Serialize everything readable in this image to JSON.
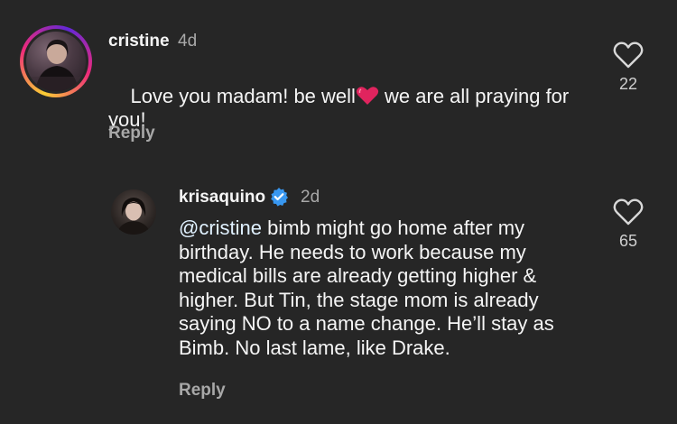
{
  "comment": {
    "username": "cristine",
    "time": "4d",
    "text_line1": "Love you madam! be well",
    "text_line1b": " we are all praying for",
    "text_line2": "you!",
    "emoji": "red-heart",
    "reply_label": "Reply",
    "likes": "22"
  },
  "reply": {
    "username": "krisaquino",
    "verified": true,
    "time": "2d",
    "mention": "@cristine",
    "lines": [
      " bimb might go home after my",
      "birthday. He needs to work because my",
      "medical bills are already getting higher &",
      "higher. But Tin, the stage mom is already",
      "saying NO to a name change. He’ll stay as",
      "Bimb. No last lame, like Drake."
    ],
    "reply_label": "Reply",
    "likes": "65"
  },
  "colors": {
    "background": "#262626",
    "text": "#f5f5f5",
    "secondary": "#a8a8a8",
    "mention": "#e0f1ff",
    "verified": "#3897f0",
    "heart": "#e0245e"
  }
}
